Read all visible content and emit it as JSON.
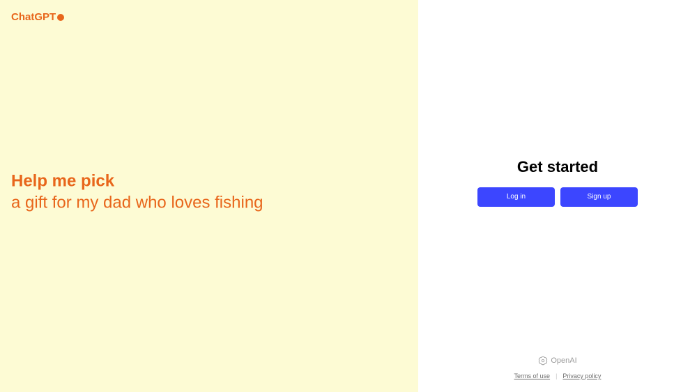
{
  "brand": {
    "name": "ChatGPT"
  },
  "prompt": {
    "line1": "Help me pick",
    "line2": "a gift for my dad who loves fishing"
  },
  "auth": {
    "title": "Get started",
    "login_label": "Log in",
    "signup_label": "Sign up"
  },
  "footer": {
    "company": "OpenAI",
    "terms_label": "Terms of use",
    "privacy_label": "Privacy policy"
  }
}
